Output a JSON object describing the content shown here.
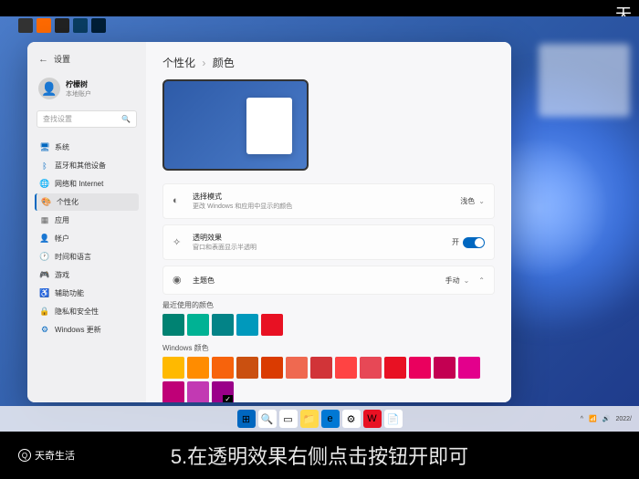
{
  "watermarks": {
    "top_right": "天",
    "bottom_left": "天奇生活"
  },
  "caption": "5.在透明效果右侧点击按钮开即可",
  "window": {
    "title": "设置",
    "user": {
      "name": "柠檬树",
      "sub": "本地账户"
    },
    "search_placeholder": "查找设置",
    "nav": [
      {
        "icon": "🖥",
        "label": "系统",
        "color": "#0067c0"
      },
      {
        "icon": "ᛒ",
        "label": "蓝牙和其他设备",
        "color": "#0067c0"
      },
      {
        "icon": "🌐",
        "label": "网络和 Internet",
        "color": "#0067c0"
      },
      {
        "icon": "🎨",
        "label": "个性化",
        "color": "#333",
        "active": true
      },
      {
        "icon": "▦",
        "label": "应用",
        "color": "#666"
      },
      {
        "icon": "👤",
        "label": "帐户",
        "color": "#666"
      },
      {
        "icon": "🕐",
        "label": "时间和语言",
        "color": "#666"
      },
      {
        "icon": "🎮",
        "label": "游戏",
        "color": "#666"
      },
      {
        "icon": "♿",
        "label": "辅助功能",
        "color": "#666"
      },
      {
        "icon": "🔒",
        "label": "隐私和安全性",
        "color": "#666"
      },
      {
        "icon": "⚙",
        "label": "Windows 更新",
        "color": "#0067c0"
      }
    ]
  },
  "content": {
    "breadcrumb": {
      "parent": "个性化",
      "current": "颜色"
    },
    "settings": [
      {
        "icon": "◐",
        "title": "选择模式",
        "sub": "更改 Windows 和应用中显示的颜色",
        "ctrl_text": "浅色",
        "type": "dropdown"
      },
      {
        "icon": "✧",
        "title": "透明效果",
        "sub": "窗口和表面显示半透明",
        "ctrl_text": "开",
        "type": "toggle"
      },
      {
        "icon": "◉",
        "title": "主题色",
        "sub": "",
        "ctrl_text": "手动",
        "type": "dropdown-expand"
      }
    ],
    "recent_label": "最近使用的颜色",
    "recent_colors": [
      "#008272",
      "#00b294",
      "#038387",
      "#0099bc",
      "#e81123"
    ],
    "win_colors_label": "Windows 颜色",
    "win_colors_row1": [
      "#ffb900",
      "#ff8c00",
      "#f7630c",
      "#ca5010",
      "#da3b01",
      "#ef6950",
      "#d13438",
      "#ff4343"
    ],
    "win_colors_row2": [
      "#e74856",
      "#e81123",
      "#ea005e",
      "#c30052",
      "#e3008c",
      "#bf0077",
      "#c239b3",
      "#9a0089"
    ],
    "selected_color": "#9a0089"
  },
  "taskbar": {
    "apps": [
      {
        "bg": "#0067c0",
        "char": "⊞"
      },
      {
        "bg": "#fff",
        "char": "🔍"
      },
      {
        "bg": "#fff",
        "char": "▭"
      },
      {
        "bg": "#ffd94a",
        "char": "📁"
      },
      {
        "bg": "#0078d4",
        "char": "e"
      },
      {
        "bg": "#fff",
        "char": "⚙"
      },
      {
        "bg": "#e81123",
        "char": "W"
      },
      {
        "bg": "#fff",
        "char": "📄"
      }
    ],
    "right": {
      "date": "2022/"
    }
  }
}
